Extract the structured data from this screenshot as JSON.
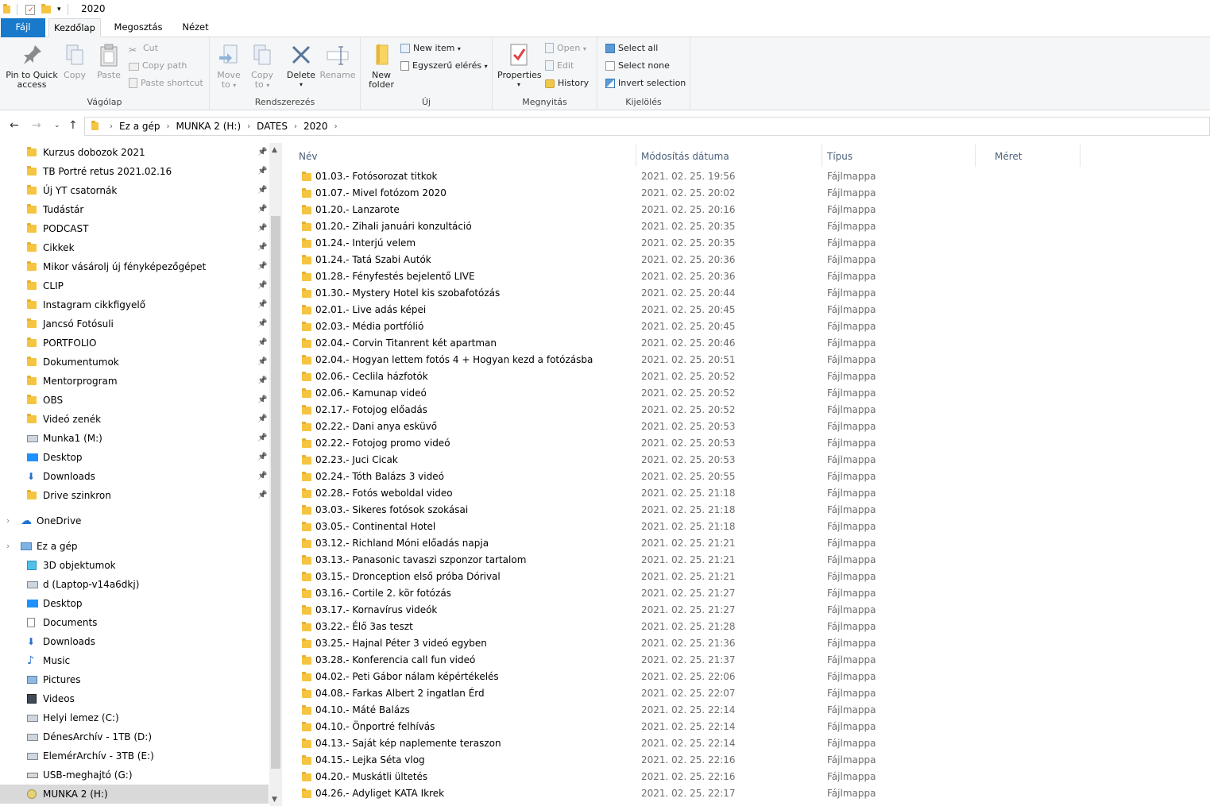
{
  "window": {
    "title": "2020"
  },
  "tabs": [
    {
      "label": "Fájl"
    },
    {
      "label": "Kezdőlap"
    },
    {
      "label": "Megosztás"
    },
    {
      "label": "Nézet"
    }
  ],
  "ribbon": {
    "clipboard": {
      "group_label": "Vágólap",
      "pin_line1": "Pin to Quick",
      "pin_line2": "access",
      "copy": "Copy",
      "paste": "Paste",
      "cut": "Cut",
      "copy_path": "Copy path",
      "paste_shortcut": "Paste shortcut"
    },
    "organize": {
      "group_label": "Rendszerezés",
      "move_line1": "Move",
      "move_line2": "to",
      "copy_line1": "Copy",
      "copy_line2": "to",
      "delete": "Delete",
      "rename": "Rename"
    },
    "new": {
      "group_label": "Új",
      "new_folder_line1": "New",
      "new_folder_line2": "folder",
      "new_item": "New item",
      "easy_access": "Egyszerű elérés"
    },
    "open": {
      "group_label": "Megnyitás",
      "properties": "Properties",
      "open": "Open",
      "edit": "Edit",
      "history": "History"
    },
    "select": {
      "group_label": "Kijelölés",
      "select_all": "Select all",
      "select_none": "Select none",
      "invert": "Invert selection"
    }
  },
  "address": {
    "crumbs": [
      "Ez a gép",
      "MUNKA 2 (H:)",
      "DATES",
      "2020"
    ]
  },
  "sidebar": {
    "quick": [
      {
        "label": "Kurzus dobozok 2021"
      },
      {
        "label": "TB Portré retus 2021.02.16"
      },
      {
        "label": "Új YT csatornák"
      },
      {
        "label": "Tudástár"
      },
      {
        "label": "PODCAST"
      },
      {
        "label": "Cikkek"
      },
      {
        "label": "Mikor vásárolj új fényképezőgépet"
      },
      {
        "label": "CLIP"
      },
      {
        "label": "Instagram cikkfigyelő"
      },
      {
        "label": "Jancsó Fotósuli"
      },
      {
        "label": "PORTFOLIO"
      },
      {
        "label": "Dokumentumok"
      },
      {
        "label": "Mentorprogram"
      },
      {
        "label": "OBS"
      },
      {
        "label": "Videó zenék"
      },
      {
        "label": "Munka1 (M:)"
      },
      {
        "label": "Desktop"
      },
      {
        "label": "Downloads"
      },
      {
        "label": "Drive szinkron"
      }
    ],
    "onedrive": "OneDrive",
    "thispc": "Ez a gép",
    "pc_items": [
      {
        "label": "3D objektumok"
      },
      {
        "label": "d (Laptop-v14a6dkj)"
      },
      {
        "label": "Desktop"
      },
      {
        "label": "Documents"
      },
      {
        "label": "Downloads"
      },
      {
        "label": "Music"
      },
      {
        "label": "Pictures"
      },
      {
        "label": "Videos"
      },
      {
        "label": "Helyi lemez (C:)"
      },
      {
        "label": "DénesArchív - 1TB (D:)"
      },
      {
        "label": "ElemérArchív - 3TB (E:)"
      },
      {
        "label": "USB-meghajtó (G:)"
      },
      {
        "label": "MUNKA 2 (H:)"
      }
    ]
  },
  "columns": {
    "name": "Név",
    "date": "Módosítás dátuma",
    "type": "Típus",
    "size": "Méret"
  },
  "files": [
    {
      "name": "01.03.- Fotósorozat titkok",
      "date": "2021. 02. 25. 19:56",
      "type": "Fájlmappa"
    },
    {
      "name": "01.07.- Mivel fotózom 2020",
      "date": "2021. 02. 25. 20:02",
      "type": "Fájlmappa"
    },
    {
      "name": "01.20.- Lanzarote",
      "date": "2021. 02. 25. 20:16",
      "type": "Fájlmappa"
    },
    {
      "name": "01.20.- Zihali januári konzultáció",
      "date": "2021. 02. 25. 20:35",
      "type": "Fájlmappa"
    },
    {
      "name": "01.24.- Interjú velem",
      "date": "2021. 02. 25. 20:35",
      "type": "Fájlmappa"
    },
    {
      "name": "01.24.- Tatá Szabi Autók",
      "date": "2021. 02. 25. 20:36",
      "type": "Fájlmappa"
    },
    {
      "name": "01.28.- Fényfestés bejelentő LIVE",
      "date": "2021. 02. 25. 20:36",
      "type": "Fájlmappa"
    },
    {
      "name": "01.30.- Mystery Hotel kis szobafotózás",
      "date": "2021. 02. 25. 20:44",
      "type": "Fájlmappa"
    },
    {
      "name": "02.01.- Live adás képei",
      "date": "2021. 02. 25. 20:45",
      "type": "Fájlmappa"
    },
    {
      "name": "02.03.- Média portfólió",
      "date": "2021. 02. 25. 20:45",
      "type": "Fájlmappa"
    },
    {
      "name": "02.04.- Corvin Titanrent két apartman",
      "date": "2021. 02. 25. 20:46",
      "type": "Fájlmappa"
    },
    {
      "name": "02.04.- Hogyan lettem fotós 4 + Hogyan kezd a fotózásba",
      "date": "2021. 02. 25. 20:51",
      "type": "Fájlmappa"
    },
    {
      "name": "02.06.- Ceclila házfotók",
      "date": "2021. 02. 25. 20:52",
      "type": "Fájlmappa"
    },
    {
      "name": "02.06.- Kamunap videó",
      "date": "2021. 02. 25. 20:52",
      "type": "Fájlmappa"
    },
    {
      "name": "02.17.- Fotojog előadás",
      "date": "2021. 02. 25. 20:52",
      "type": "Fájlmappa"
    },
    {
      "name": "02.22.- Dani anya esküvő",
      "date": "2021. 02. 25. 20:53",
      "type": "Fájlmappa"
    },
    {
      "name": "02.22.- Fotojog promo videó",
      "date": "2021. 02. 25. 20:53",
      "type": "Fájlmappa"
    },
    {
      "name": "02.23.- Juci Cicak",
      "date": "2021. 02. 25. 20:53",
      "type": "Fájlmappa"
    },
    {
      "name": "02.24.- Tóth Balázs 3 videó",
      "date": "2021. 02. 25. 20:55",
      "type": "Fájlmappa"
    },
    {
      "name": "02.28.- Fotós weboldal video",
      "date": "2021. 02. 25. 21:18",
      "type": "Fájlmappa"
    },
    {
      "name": "03.03.- Sikeres fotósok szokásai",
      "date": "2021. 02. 25. 21:18",
      "type": "Fájlmappa"
    },
    {
      "name": "03.05.- Continental Hotel",
      "date": "2021. 02. 25. 21:18",
      "type": "Fájlmappa"
    },
    {
      "name": "03.12.- Richland Móni előadás napja",
      "date": "2021. 02. 25. 21:21",
      "type": "Fájlmappa"
    },
    {
      "name": "03.13.- Panasonic tavaszi szponzor tartalom",
      "date": "2021. 02. 25. 21:21",
      "type": "Fájlmappa"
    },
    {
      "name": "03.15.- Dronception első próba Dórival",
      "date": "2021. 02. 25. 21:21",
      "type": "Fájlmappa"
    },
    {
      "name": "03.16.- Cortile 2. kör fotózás",
      "date": "2021. 02. 25. 21:27",
      "type": "Fájlmappa"
    },
    {
      "name": "03.17.- Kornavírus videók",
      "date": "2021. 02. 25. 21:27",
      "type": "Fájlmappa"
    },
    {
      "name": "03.22.- Élő 3as teszt",
      "date": "2021. 02. 25. 21:28",
      "type": "Fájlmappa"
    },
    {
      "name": "03.25.- Hajnal Péter 3 videó egyben",
      "date": "2021. 02. 25. 21:36",
      "type": "Fájlmappa"
    },
    {
      "name": "03.28.- Konferencia call fun videó",
      "date": "2021. 02. 25. 21:37",
      "type": "Fájlmappa"
    },
    {
      "name": "04.02.- Peti Gábor nálam képértékelés",
      "date": "2021. 02. 25. 22:06",
      "type": "Fájlmappa"
    },
    {
      "name": "04.08.- Farkas Albert 2 ingatlan Érd",
      "date": "2021. 02. 25. 22:07",
      "type": "Fájlmappa"
    },
    {
      "name": "04.10.- Máté Balázs",
      "date": "2021. 02. 25. 22:14",
      "type": "Fájlmappa"
    },
    {
      "name": "04.10.- Önportré felhívás",
      "date": "2021. 02. 25. 22:14",
      "type": "Fájlmappa"
    },
    {
      "name": "04.13.- Saját kép naplemente teraszon",
      "date": "2021. 02. 25. 22:14",
      "type": "Fájlmappa"
    },
    {
      "name": "04.15.- Lejka Séta vlog",
      "date": "2021. 02. 25. 22:16",
      "type": "Fájlmappa"
    },
    {
      "name": "04.20.- Muskátli ültetés",
      "date": "2021. 02. 25. 22:16",
      "type": "Fájlmappa"
    },
    {
      "name": "04.26.- Adyliget KATA Ikrek",
      "date": "2021. 02. 25. 22:17",
      "type": "Fájlmappa"
    }
  ]
}
